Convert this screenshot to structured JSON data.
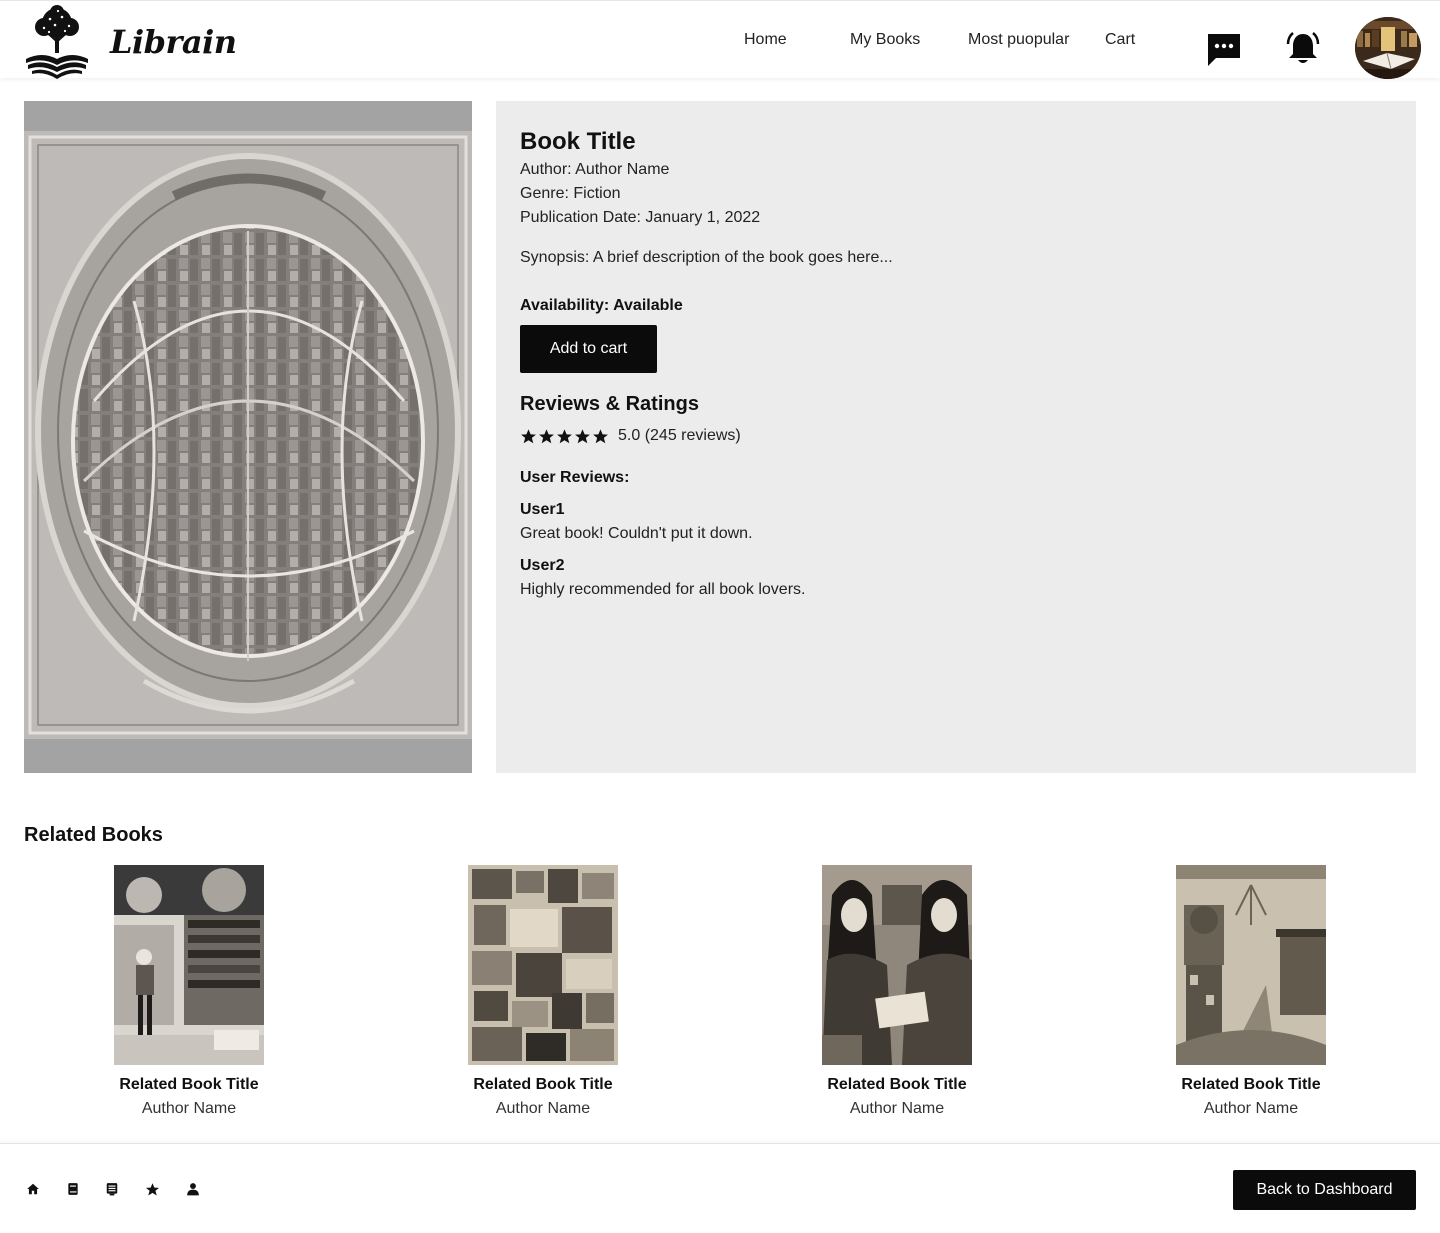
{
  "header": {
    "brand": "Librain",
    "nav": {
      "home": "Home",
      "my_books": "My Books",
      "most_popular": "Most puopular",
      "cart": "Cart"
    },
    "icons": [
      "chat-icon",
      "bell-icon",
      "avatar"
    ]
  },
  "book": {
    "title": "Book Title",
    "author": "Author: Author Name",
    "genre": "Genre: Fiction",
    "publication_date": "Publication Date: January 1, 2022",
    "synopsis": "Synopsis: A brief description of the book goes here...",
    "availability": "Availability: Available",
    "add_to_cart_label": "Add to cart"
  },
  "reviews": {
    "heading": "Reviews & Ratings",
    "stars": 5,
    "rating_text": "5.0 (245 reviews)",
    "user_reviews_label": "User Reviews:",
    "items": [
      {
        "user": "User1",
        "text": "Great book! Couldn't put it down."
      },
      {
        "user": "User2",
        "text": "Highly recommended for all book lovers."
      }
    ]
  },
  "related": {
    "heading": "Related Books",
    "items": [
      {
        "title": "Related Book Title",
        "author": "Author Name"
      },
      {
        "title": "Related Book Title",
        "author": "Author Name"
      },
      {
        "title": "Related Book Title",
        "author": "Author Name"
      },
      {
        "title": "Related Book Title",
        "author": "Author Name"
      }
    ]
  },
  "footer": {
    "icons": [
      "home-icon",
      "book-icon",
      "list-icon",
      "star-icon",
      "user-icon"
    ],
    "back_label": "Back to Dashboard"
  },
  "colors": {
    "primary_button": "#0b0b0b",
    "details_panel": "#ececec"
  }
}
